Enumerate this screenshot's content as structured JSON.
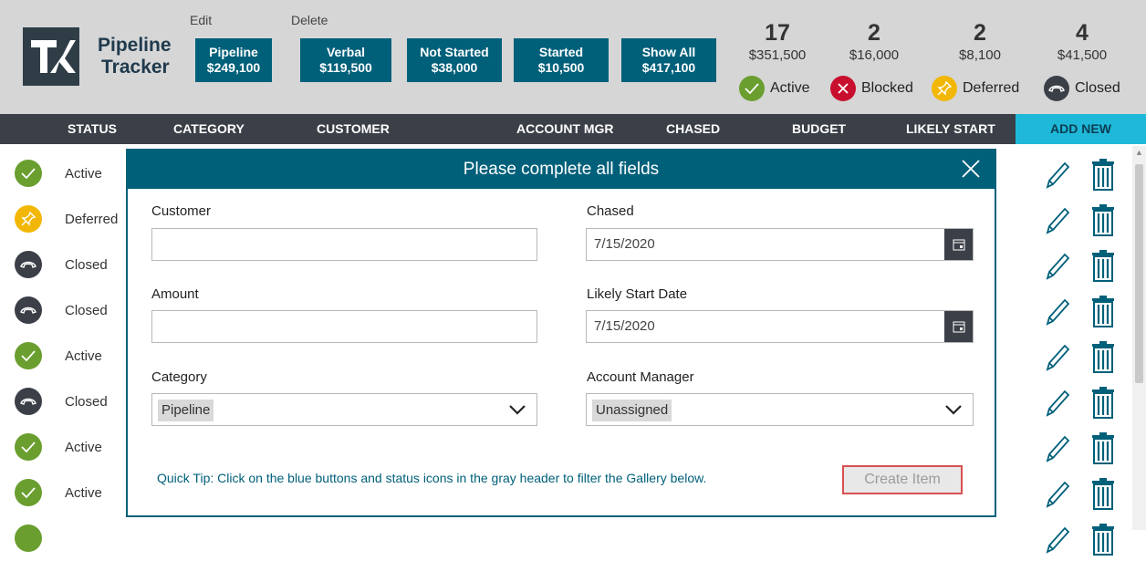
{
  "app": {
    "title_line1": "Pipeline",
    "title_line2": "Tracker",
    "logo_text": "TK"
  },
  "links": {
    "edit": "Edit",
    "delete": "Delete"
  },
  "filters": [
    {
      "label": "Pipeline",
      "amount": "$249,100"
    },
    {
      "label": "Verbal",
      "amount": "$119,500"
    },
    {
      "label": "Not Started",
      "amount": "$38,000"
    },
    {
      "label": "Started",
      "amount": "$10,500"
    },
    {
      "label": "Show All",
      "amount": "$417,100"
    }
  ],
  "stats": [
    {
      "count": "17",
      "amount": "$351,500",
      "label": "Active",
      "icon": "check-icon",
      "color": "#6a9e2f"
    },
    {
      "count": "2",
      "amount": "$16,000",
      "label": "Blocked",
      "icon": "x-icon",
      "color": "#c8102e"
    },
    {
      "count": "2",
      "amount": "$8,100",
      "label": "Deferred",
      "icon": "pushpin-icon",
      "color": "#f2b705"
    },
    {
      "count": "4",
      "amount": "$41,500",
      "label": "Closed",
      "icon": "phone-hangup-icon",
      "color": "#3b3f47"
    }
  ],
  "columns": [
    "STATUS",
    "CATEGORY",
    "CUSTOMER",
    "ACCOUNT MGR",
    "CHASED",
    "BUDGET",
    "LIKELY START"
  ],
  "add_new": "ADD NEW",
  "rows": [
    {
      "status": "Active"
    },
    {
      "status": "Deferred"
    },
    {
      "status": "Closed"
    },
    {
      "status": "Closed"
    },
    {
      "status": "Active"
    },
    {
      "status": "Closed"
    },
    {
      "status": "Active"
    },
    {
      "status": "Active"
    }
  ],
  "modal": {
    "title": "Please complete all fields",
    "customer_label": "Customer",
    "customer_value": "",
    "amount_label": "Amount",
    "amount_value": "",
    "category_label": "Category",
    "category_value": "Pipeline",
    "chased_label": "Chased",
    "chased_value": "7/15/2020",
    "likely_start_label": "Likely Start Date",
    "likely_start_value": "7/15/2020",
    "account_manager_label": "Account Manager",
    "account_manager_value": "Unassigned",
    "tip": "Quick Tip: Click on the blue buttons and status icons in the gray header to filter the Gallery below.",
    "create_button": "Create Item"
  },
  "colors": {
    "header_bg": "#d6d6d6",
    "button_blue": "#00607a",
    "column_bar": "#3b3f47",
    "add_new": "#1fb8d8",
    "active_green": "#6a9e2f",
    "deferred_yellow": "#f2b705",
    "closed_dark": "#3b3f47",
    "blocked_red": "#c8102e"
  }
}
